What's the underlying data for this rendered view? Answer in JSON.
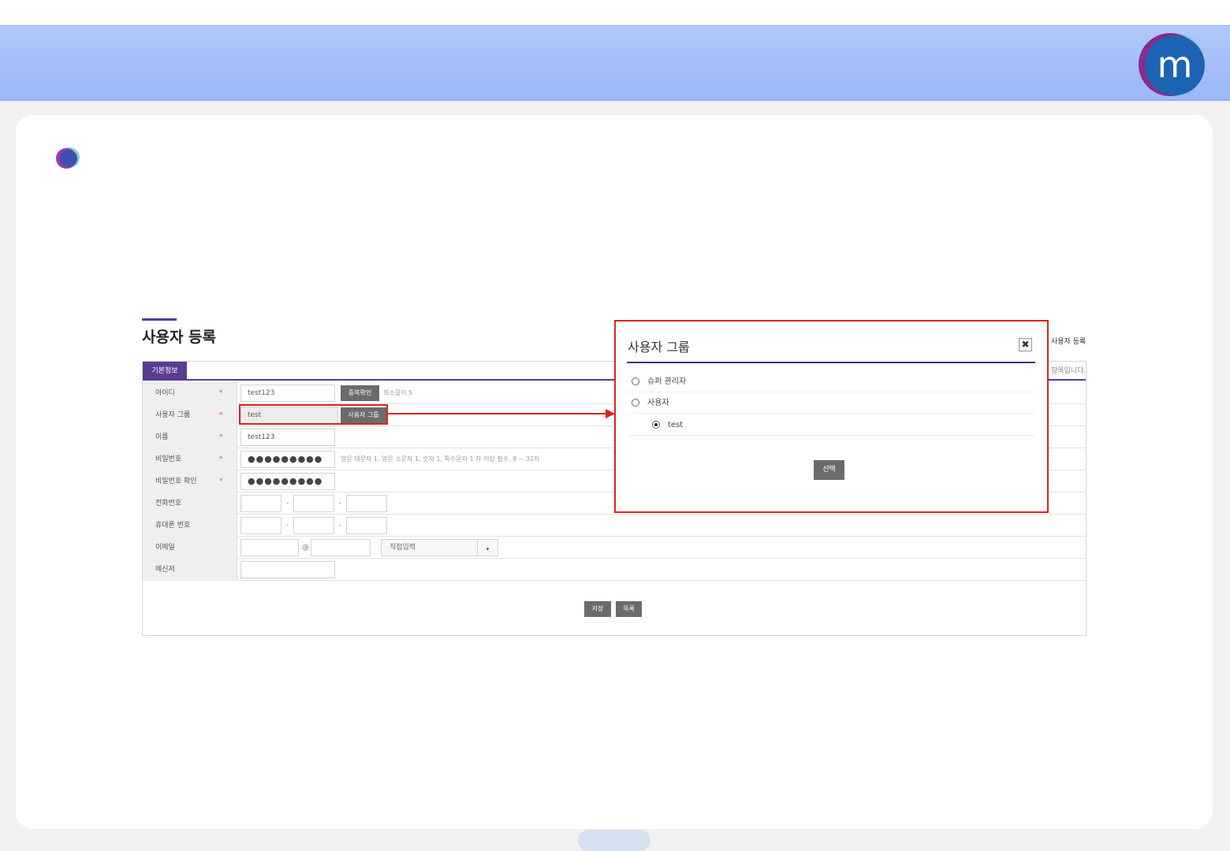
{
  "header": {
    "logo_letter": "m"
  },
  "page": {
    "title": "사용자 등록",
    "breadcrumb": "사용자 등록",
    "notice": "항목입니다."
  },
  "form": {
    "tab_label": "기본정보",
    "required_mark": "*",
    "rows": {
      "id": {
        "label": "아이디",
        "value": "test123",
        "button": "중복확인",
        "hint": "최소길이 5"
      },
      "group": {
        "label": "사용자 그룹",
        "value": "test",
        "button": "사용자 그룹"
      },
      "name": {
        "label": "이름",
        "value": "test123"
      },
      "password": {
        "label": "비밀번호",
        "value": "●●●●●●●●●",
        "hint": "영문 대문자 1, 영문 소문자 1, 숫자 1, 특수문자 1 자 이상 필수. 8 ~ 32자"
      },
      "password_confirm": {
        "label": "비밀번호 확인",
        "value": "●●●●●●●●●"
      },
      "phone": {
        "label": "전화번호",
        "separator": "-"
      },
      "mobile": {
        "label": "휴대폰 번호",
        "separator": "-"
      },
      "email": {
        "label": "이메일",
        "at": "@",
        "domain_select": "직접입력",
        "arrow": "▾"
      },
      "messenger": {
        "label": "메신저"
      }
    },
    "save_label": "저장",
    "list_label": "목록"
  },
  "modal": {
    "title": "사용자 그룹",
    "close_glyph": "✖",
    "options": [
      {
        "label": "슈퍼 관리자",
        "selected": false
      },
      {
        "label": "사용자",
        "selected": false
      },
      {
        "label": "test",
        "selected": true
      }
    ],
    "select_label": "선택"
  },
  "colors": {
    "accent_purple": "#5b3c93",
    "highlight_red": "#e02020",
    "banner_blue": "#a5c0fb"
  }
}
